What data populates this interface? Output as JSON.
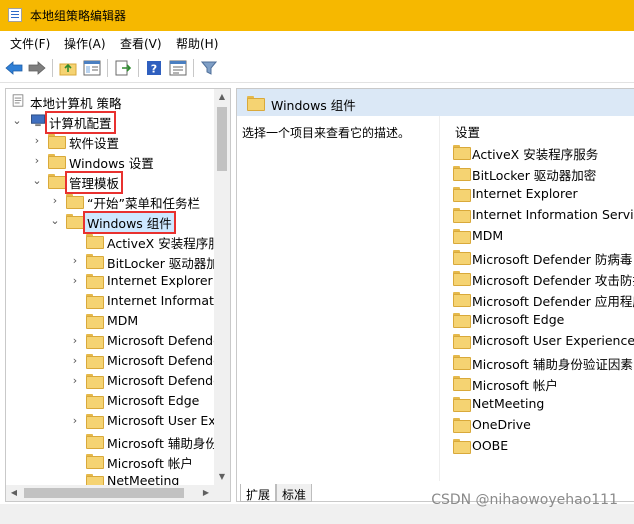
{
  "window": {
    "title": "本地组策略编辑器"
  },
  "menu": {
    "file": "文件(F)",
    "action": "操作(A)",
    "view": "查看(V)",
    "help": "帮助(H)"
  },
  "toolbar": {
    "icons": [
      "back-arrow-icon",
      "forward-arrow-icon",
      "up-folder-icon",
      "show-hide-tree-icon",
      "export-list-icon",
      "help-icon",
      "properties-icon",
      "filter-icon"
    ]
  },
  "tree": {
    "root": "本地计算机 策略",
    "computer_config": "计算机配置",
    "software_settings": "软件设置",
    "windows_settings": "Windows 设置",
    "admin_templates": "管理模板",
    "start_menu": "“开始”菜单和任务栏",
    "windows_components": "Windows 组件",
    "children": [
      "ActiveX 安装程序服",
      "BitLocker 驱动器加",
      "Internet Explorer",
      "Internet Informatio",
      "MDM",
      "Microsoft Defende",
      "Microsoft Defende",
      "Microsoft Defende",
      "Microsoft Edge",
      "Microsoft User Exp",
      "Microsoft 辅助身份",
      "Microsoft 帐户",
      "NetMeeting"
    ]
  },
  "details": {
    "header": "Windows 组件",
    "description": "选择一个项目来查看它的描述。",
    "column": "设置",
    "items": [
      "ActiveX 安装程序服务",
      "BitLocker 驱动器加密",
      "Internet Explorer",
      "Internet Information Service",
      "MDM",
      "Microsoft Defender 防病毒",
      "Microsoft Defender 攻击防护",
      "Microsoft Defender 应用程序",
      "Microsoft Edge",
      "Microsoft User Experience V",
      "Microsoft 辅助身份验证因素",
      "Microsoft 帐户",
      "NetMeeting",
      "OneDrive",
      "OOBE"
    ]
  },
  "tabs": {
    "extended": "扩展",
    "standard": "标准"
  },
  "watermark": "CSDN @nihaowoyehao111",
  "colors": {
    "titlebar": "#f6b800",
    "highlight_box": "#e8312f",
    "header_band": "#dbe8f6"
  }
}
